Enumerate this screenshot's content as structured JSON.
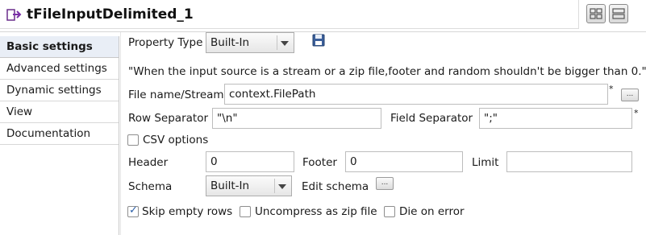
{
  "header": {
    "title": "tFileInputDelimited_1",
    "component_icon": "file-input-icon",
    "layout_buttons": [
      "grid-layout-icon",
      "stack-layout-icon"
    ]
  },
  "sidebar": {
    "items": [
      {
        "label": "Basic settings",
        "active": true
      },
      {
        "label": "Advanced settings",
        "active": false
      },
      {
        "label": "Dynamic settings",
        "active": false
      },
      {
        "label": "View",
        "active": false
      },
      {
        "label": "Documentation",
        "active": false
      }
    ]
  },
  "form": {
    "property_type_label": "Property Type",
    "property_type_value": "Built-In",
    "save_icon": "save-icon",
    "warning": "\"When the input source is a stream or a zip file,footer and random shouldn't be bigger than 0.\"",
    "file_label": "File name/Stream",
    "file_value": "context.FilePath",
    "required_mark": "*",
    "browse_label": "...",
    "row_sep_label": "Row Separator",
    "row_sep_value": "\"\\n\"",
    "field_sep_label": "Field Separator",
    "field_sep_value": "\";\"",
    "csv_options_label": "CSV options",
    "csv_options_checked": false,
    "header_label": "Header",
    "header_value": "0",
    "footer_label": "Footer",
    "footer_value": "0",
    "limit_label": "Limit",
    "limit_value": "",
    "schema_label": "Schema",
    "schema_value": "Built-In",
    "edit_schema_label": "Edit schema",
    "skip_empty_label": "Skip empty rows",
    "skip_empty_checked": true,
    "uncompress_label": "Uncompress as zip file",
    "uncompress_checked": false,
    "die_on_error_label": "Die on error",
    "die_on_error_checked": false
  }
}
